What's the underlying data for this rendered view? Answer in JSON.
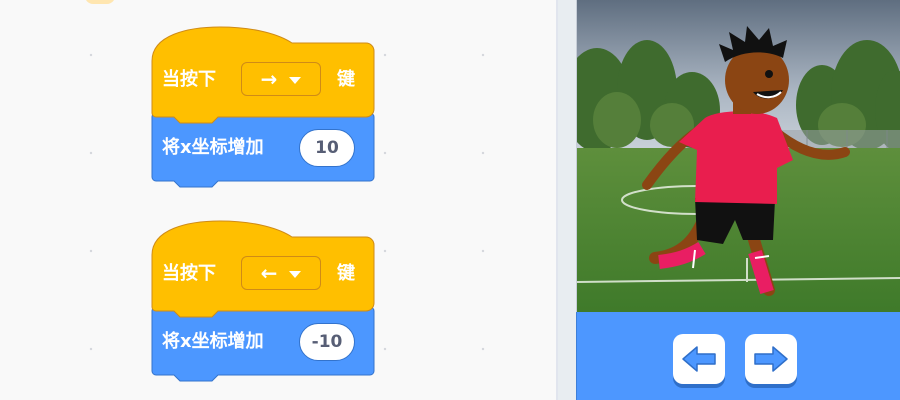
{
  "workspace": {
    "scripts": [
      {
        "hat": {
          "label": "当按下",
          "key": "→",
          "suffix": "键"
        },
        "motion": {
          "label": "将x坐标增加",
          "value": "10"
        }
      },
      {
        "hat": {
          "label": "当按下",
          "key": "←",
          "suffix": "键"
        },
        "motion": {
          "label": "将x坐标增加",
          "value": "-10"
        }
      }
    ]
  },
  "colors": {
    "events_block": "#ffbf00",
    "events_border": "#cf8b17",
    "motion_block": "#4c97ff",
    "motion_border": "#3373cc",
    "controls_bar": "#4d97ff"
  },
  "stage": {
    "sprite": "soccer-player",
    "backdrop": "soccer-field"
  },
  "controls": {
    "left_button_icon": "left-arrow-icon",
    "right_button_icon": "right-arrow-icon"
  }
}
